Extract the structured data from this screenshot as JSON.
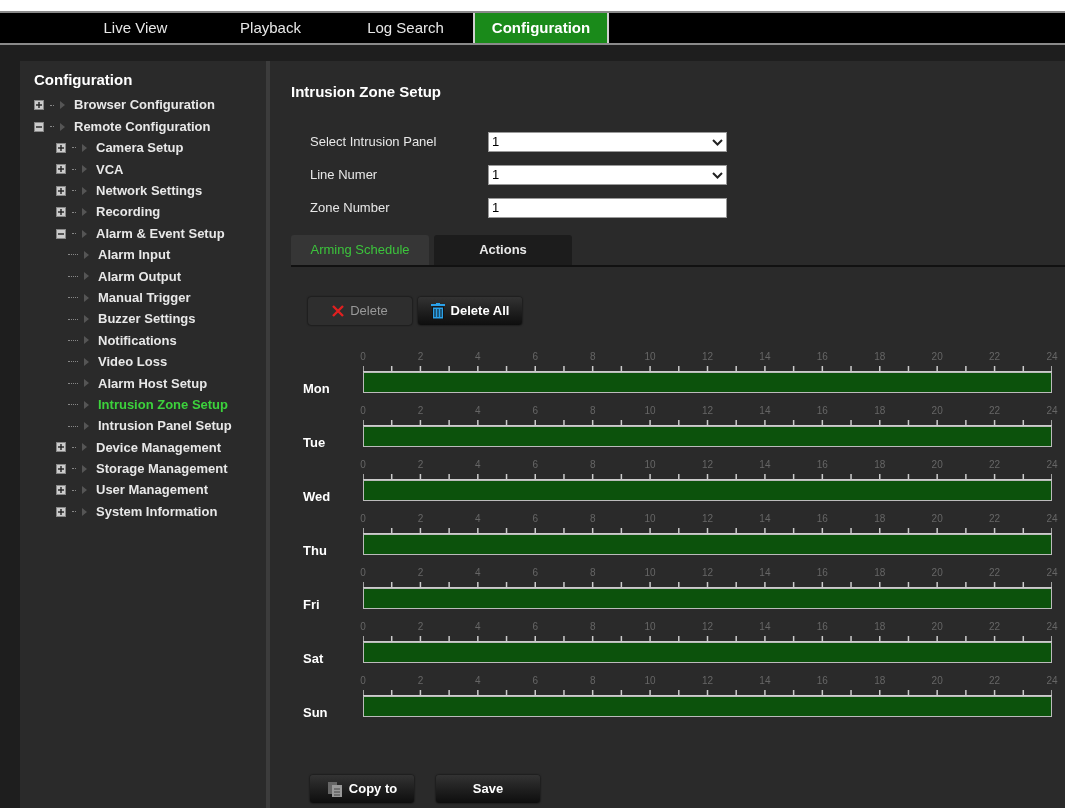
{
  "top_tabs": [
    {
      "label": "Live View",
      "selected": false
    },
    {
      "label": "Playback",
      "selected": false
    },
    {
      "label": "Log Search",
      "selected": false
    },
    {
      "label": "Configuration",
      "selected": true
    }
  ],
  "sidebar": {
    "title": "Configuration",
    "items": [
      {
        "label": "Browser Configuration",
        "expanded": false,
        "selected": false
      },
      {
        "label": "Remote Configuration",
        "expanded": true,
        "selected": false,
        "children": [
          {
            "label": "Camera Setup",
            "expanded": false,
            "selected": false
          },
          {
            "label": "VCA",
            "expanded": false,
            "selected": false
          },
          {
            "label": "Network Settings",
            "expanded": false,
            "selected": false
          },
          {
            "label": "Recording",
            "expanded": false,
            "selected": false
          },
          {
            "label": "Alarm & Event Setup",
            "expanded": true,
            "selected": false,
            "children": [
              {
                "label": "Alarm Input",
                "selected": false
              },
              {
                "label": "Alarm Output",
                "selected": false
              },
              {
                "label": "Manual Trigger",
                "selected": false
              },
              {
                "label": "Buzzer Settings",
                "selected": false
              },
              {
                "label": "Notifications",
                "selected": false
              },
              {
                "label": "Video Loss",
                "selected": false
              },
              {
                "label": "Alarm Host Setup",
                "selected": false
              },
              {
                "label": "Intrusion Zone Setup",
                "selected": true
              },
              {
                "label": "Intrusion Panel Setup",
                "selected": false
              }
            ]
          },
          {
            "label": "Device Management",
            "expanded": false,
            "selected": false
          },
          {
            "label": "Storage Management",
            "expanded": false,
            "selected": false
          },
          {
            "label": "User Management",
            "expanded": false,
            "selected": false
          },
          {
            "label": "System Information",
            "expanded": false,
            "selected": false
          }
        ]
      }
    ]
  },
  "main": {
    "title": "Intrusion Zone Setup",
    "fields": [
      {
        "label": "Select Intrusion Panel",
        "kind": "dropdown",
        "value": "1"
      },
      {
        "label": "Line Numer",
        "kind": "dropdown",
        "value": "1"
      },
      {
        "label": "Zone Number",
        "kind": "text",
        "value": "1"
      }
    ],
    "tabs": [
      {
        "label": "Arming Schedule",
        "selected": true
      },
      {
        "label": "Actions",
        "selected": false
      }
    ],
    "schedule_buttons": [
      {
        "label": "Delete",
        "kind": "delete",
        "disabled": true
      },
      {
        "label": "Delete All",
        "kind": "delete_all",
        "disabled": false
      }
    ],
    "schedule": [
      {
        "day": "Mon",
        "level": 1,
        "scale": [
          "0",
          "2",
          "4",
          "6",
          "8",
          "10",
          "12",
          "14",
          "16",
          "18",
          "20",
          "22",
          "24"
        ]
      },
      {
        "day": "Tue",
        "level": 1,
        "scale": [
          "0",
          "2",
          "4",
          "6",
          "8",
          "10",
          "12",
          "14",
          "16",
          "18",
          "20",
          "22",
          "24"
        ]
      },
      {
        "day": "Wed",
        "level": 1,
        "scale": [
          "0",
          "2",
          "4",
          "6",
          "8",
          "10",
          "12",
          "14",
          "16",
          "18",
          "20",
          "22",
          "24"
        ]
      },
      {
        "day": "Thu",
        "level": 1,
        "scale": [
          "0",
          "2",
          "4",
          "6",
          "8",
          "10",
          "12",
          "14",
          "16",
          "18",
          "20",
          "22",
          "24"
        ]
      },
      {
        "day": "Fri",
        "level": 1,
        "scale": [
          "0",
          "2",
          "4",
          "6",
          "8",
          "10",
          "12",
          "14",
          "16",
          "18",
          "20",
          "22",
          "24"
        ]
      },
      {
        "day": "Sat",
        "level": 1,
        "scale": [
          "0",
          "2",
          "4",
          "6",
          "8",
          "10",
          "12",
          "14",
          "16",
          "18",
          "20",
          "22",
          "24"
        ]
      },
      {
        "day": "Sun",
        "level": 1,
        "scale": [
          "0",
          "2",
          "4",
          "6",
          "8",
          "10",
          "12",
          "14",
          "16",
          "18",
          "20",
          "22",
          "24"
        ]
      }
    ],
    "bottom_buttons": [
      {
        "label": "Copy to",
        "kind": "copy"
      },
      {
        "label": "Save",
        "kind": "plain"
      }
    ]
  }
}
